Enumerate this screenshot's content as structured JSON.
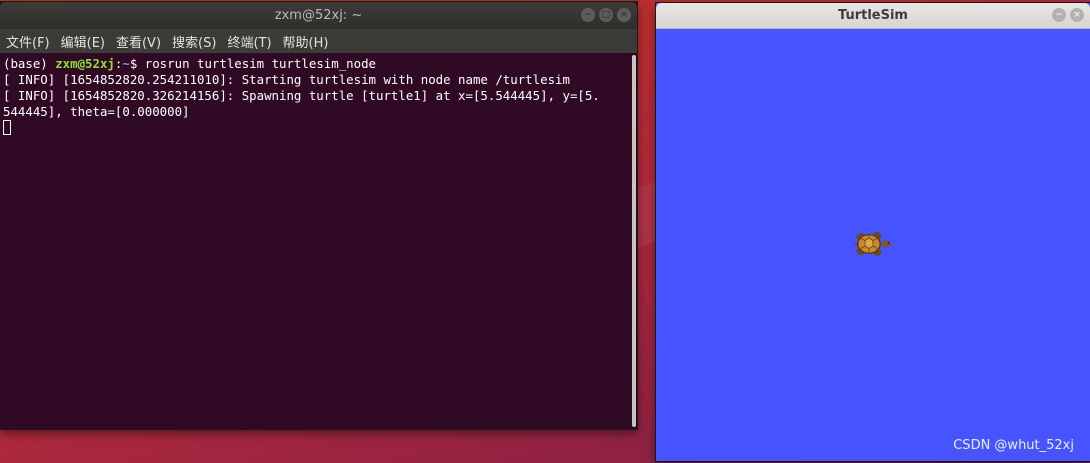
{
  "terminal": {
    "title": "zxm@52xj: ~",
    "menu": [
      {
        "label": "文件(F)"
      },
      {
        "label": "编辑(E)"
      },
      {
        "label": "查看(V)"
      },
      {
        "label": "搜索(S)"
      },
      {
        "label": "终端(T)"
      },
      {
        "label": "帮助(H)"
      }
    ],
    "controls": {
      "minimize": "−",
      "maximize": "□",
      "close": "×"
    },
    "prompt": {
      "env": "(base) ",
      "user_host": "zxm@52xj",
      "colon": ":",
      "path": "~",
      "symbol": "$ ",
      "command": "rosrun turtlesim turtlesim_node"
    },
    "output": [
      "[ INFO] [1654852820.254211010]: Starting turtlesim with node name /turtlesim",
      "[ INFO] [1654852820.326214156]: Spawning turtle [turtle1] at x=[5.544445], y=[5.",
      "544445], theta=[0.000000]"
    ],
    "colors": {
      "background": "#300a24",
      "text": "#ffffff",
      "user_host": "#8ae234",
      "path": "#729fcf"
    }
  },
  "turtlesim": {
    "title": "TurtleSim",
    "controls": {
      "minimize": "−",
      "close": "×"
    },
    "colors": {
      "background": "#4554ff"
    },
    "turtle": {
      "name": "turtle1",
      "icon": "turtle-icon"
    }
  },
  "watermark": "CSDN @whut_52xj"
}
